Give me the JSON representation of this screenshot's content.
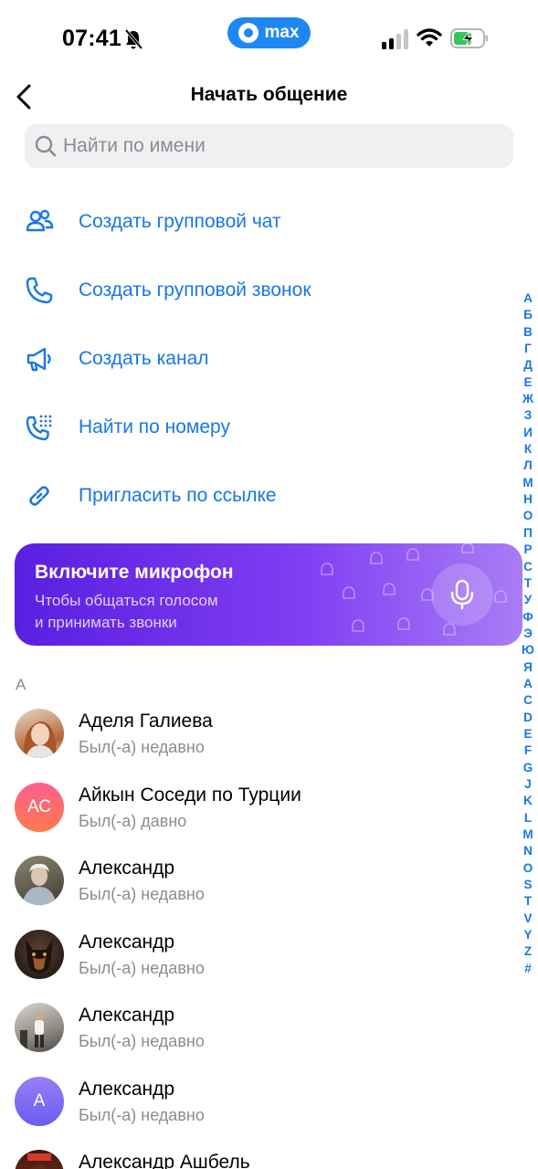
{
  "status_bar": {
    "time": "07:41",
    "app_pill": "max"
  },
  "header": {
    "title": "Начать общение"
  },
  "search": {
    "placeholder": "Найти по имени",
    "value": ""
  },
  "actions": [
    {
      "label": "Создать групповой чат",
      "icon": "group-icon"
    },
    {
      "label": "Создать групповой звонок",
      "icon": "phone-icon"
    },
    {
      "label": "Создать канал",
      "icon": "megaphone-icon"
    },
    {
      "label": "Найти по номеру",
      "icon": "dialpad-phone-icon"
    },
    {
      "label": "Пригласить по ссылке",
      "icon": "link-icon"
    }
  ],
  "mic_banner": {
    "title": "Включите микрофон",
    "subtitle_line1": "Чтобы общаться голосом",
    "subtitle_line2": "и принимать звонки"
  },
  "contacts_section": {
    "letter": "А"
  },
  "contacts": [
    {
      "name": "Аделя Галиева",
      "status": "Был(-а) недавно",
      "avatar": "photo",
      "initials": ""
    },
    {
      "name": "Айкын Соседи по Турции",
      "status": "Был(-а) давно",
      "avatar": "initials",
      "initials": "АС"
    },
    {
      "name": "Александр",
      "status": "Был(-а) недавно",
      "avatar": "photo",
      "initials": ""
    },
    {
      "name": "Александр",
      "status": "Был(-а) недавно",
      "avatar": "photo",
      "initials": ""
    },
    {
      "name": "Александр",
      "status": "Был(-а) недавно",
      "avatar": "photo",
      "initials": ""
    },
    {
      "name": "Александр",
      "status": "Был(-а) недавно",
      "avatar": "initials",
      "initials": "А"
    },
    {
      "name": "Александр Ашбель",
      "status": "",
      "avatar": "photo",
      "initials": ""
    }
  ],
  "alphabet_index": [
    "А",
    "Б",
    "В",
    "Г",
    "Д",
    "Е",
    "Ж",
    "З",
    "И",
    "К",
    "Л",
    "М",
    "Н",
    "О",
    "П",
    "Р",
    "С",
    "Т",
    "У",
    "Ф",
    "Э",
    "Ю",
    "Я",
    "A",
    "C",
    "D",
    "E",
    "F",
    "G",
    "J",
    "K",
    "L",
    "M",
    "N",
    "O",
    "S",
    "T",
    "V",
    "Y",
    "Z",
    "#"
  ],
  "colors": {
    "accent": "#1877e6",
    "banner_start": "#5a1fe0",
    "banner_end": "#a97cf6",
    "avatar_ac": "#fd5f6b",
    "avatar_a": "#8a6cf5"
  }
}
